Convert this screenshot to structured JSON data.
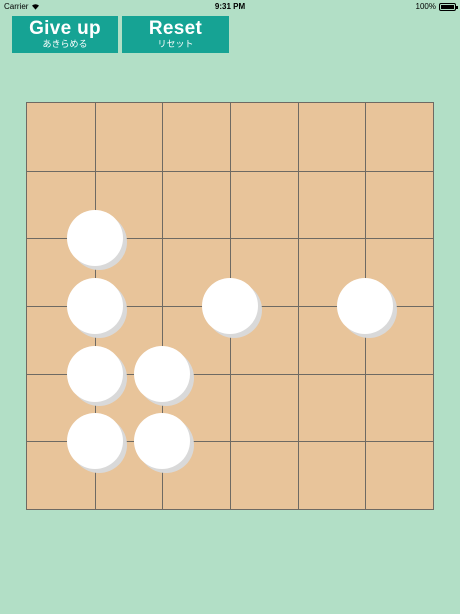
{
  "status": {
    "carrier": "Carrier",
    "time": "9:31 PM",
    "battery": "100%"
  },
  "buttons": {
    "giveup_label": "Give up",
    "giveup_sub": "あきらめる",
    "reset_label": "Reset",
    "reset_sub": "リセット"
  },
  "board": {
    "cells": 6,
    "stones": [
      {
        "col": 1,
        "row": 2,
        "color": "white"
      },
      {
        "col": 1,
        "row": 3,
        "color": "white"
      },
      {
        "col": 3,
        "row": 3,
        "color": "white"
      },
      {
        "col": 5,
        "row": 3,
        "color": "white"
      },
      {
        "col": 1,
        "row": 4,
        "color": "white"
      },
      {
        "col": 2,
        "row": 4,
        "color": "white"
      },
      {
        "col": 1,
        "row": 5,
        "color": "white"
      },
      {
        "col": 2,
        "row": 5,
        "color": "white"
      }
    ]
  },
  "colors": {
    "background": "#b2dfc6",
    "button": "#16a394",
    "board": "#e8c49a",
    "grid": "#6e6a63",
    "stone": "#ffffff"
  }
}
